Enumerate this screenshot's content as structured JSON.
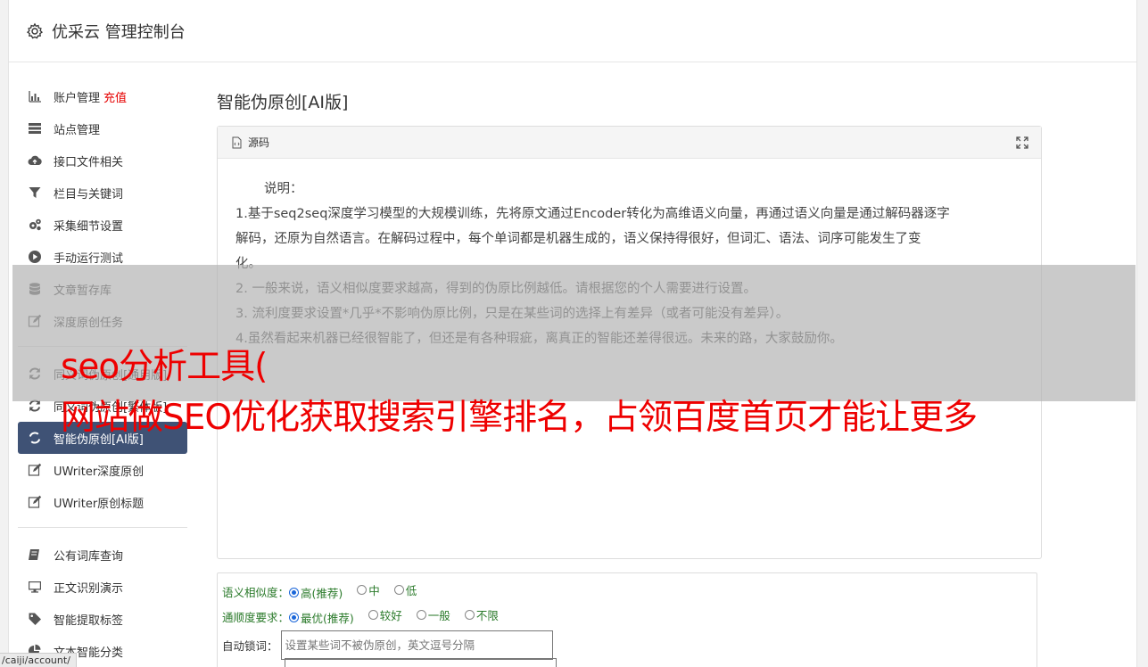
{
  "app": {
    "title": "优采云 管理控制台"
  },
  "sidebar": {
    "group1": [
      {
        "label": "账户管理",
        "extra": "充值",
        "icon": "bar-chart-icon"
      },
      {
        "label": "站点管理",
        "icon": "server-icon"
      },
      {
        "label": "接口文件相关",
        "icon": "cloud-upload-icon"
      },
      {
        "label": "栏目与关键词",
        "icon": "filter-icon"
      },
      {
        "label": "采集细节设置",
        "icon": "gears-icon"
      },
      {
        "label": "手动运行测试",
        "icon": "play-icon"
      },
      {
        "label": "文章暂存库",
        "icon": "database-icon"
      },
      {
        "label": "深度原创任务",
        "icon": "edit-icon"
      }
    ],
    "group2": [
      {
        "label": "同义词伪原创[通用版]",
        "icon": "refresh-icon"
      },
      {
        "label": "同义词伪原创[繁体版]",
        "icon": "refresh-icon"
      },
      {
        "label": "智能伪原创[AI版]",
        "icon": "refresh-icon",
        "active": true
      },
      {
        "label": "UWriter深度原创",
        "icon": "edit-icon"
      },
      {
        "label": "UWriter原创标题",
        "icon": "edit-icon"
      }
    ],
    "group3": [
      {
        "label": "公有词库查询",
        "icon": "book-icon"
      },
      {
        "label": "正文识别演示",
        "icon": "monitor-icon"
      },
      {
        "label": "智能提取标签",
        "icon": "tag-icon"
      },
      {
        "label": "文本智能分类",
        "icon": "pie-chart-icon"
      }
    ]
  },
  "main": {
    "page_title": "智能伪原创[AI版]",
    "panel_title": "源码",
    "desc_label": "说明：",
    "desc_lines": [
      "1.基于seq2seq深度学习模型的大规模训练，先将原文通过Encoder转化为高维语义向量，再通过语义向量是通过解码器逐字",
      "解码，还原为自然语言。在解码过程中，每个单词都是机器生成的，语义保持得很好，但词汇、语法、词序可能发生了变",
      "化。",
      "2. 一般来说，语义相似度要求越高，得到的伪原比例越低。请根据您的个人需要进行设置。",
      "3. 流利度要求设置*几乎*不影响伪原比例，只是在某些词的选择上有差异（或者可能没有差异）。",
      "4.虽然看起来机器已经很智能了，但还是有各种瑕疵，离真正的智能还差得很远。未来的路，大家鼓励你。"
    ]
  },
  "form": {
    "similarity_label": "语义相似度：",
    "similarity_options": [
      "高(推荐)",
      "中",
      "低"
    ],
    "similarity_selected": 0,
    "fluency_label": "通顺度要求：",
    "fluency_options": [
      "最优(推荐)",
      "较好",
      "一般",
      "不限"
    ],
    "fluency_selected": 0,
    "lock_label": "自动锁词：",
    "lock_placeholder": "设置某些词不被伪原创，英文逗号分隔"
  },
  "overlay": {
    "line1": "seo分析工具(",
    "line2": "网站做SEO优化获取搜索引擎排名，占领百度首页才能让更多"
  },
  "statusbar": {
    "url": "/caiji/account/"
  }
}
